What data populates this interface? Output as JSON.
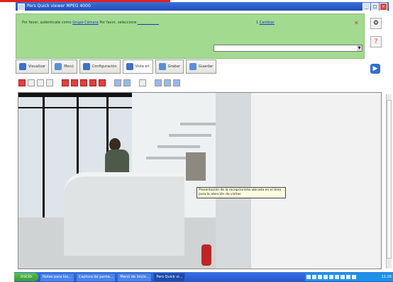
{
  "window": {
    "title": "Pers Quick viewer MPEG 4000"
  },
  "info_bar": {
    "prefix": "Por favor, autenticate como",
    "user_link": "Grupo Cámara",
    "mid": "Por favor, seleccione",
    "select_link": "____________",
    "date_link": "Cambiar",
    "close_glyph": "✕"
  },
  "tabs": [
    {
      "label": "Visualizar"
    },
    {
      "label": "Menú"
    },
    {
      "label": "Configuración"
    },
    {
      "label": "Vista en"
    },
    {
      "label": "Grabar"
    },
    {
      "label": "Guardar"
    }
  ],
  "camera": {
    "tooltip": "Presentación de la recepcionista ubicada en el área para la atención de visitas"
  },
  "taskbar": {
    "start": "Inicio",
    "tasks": [
      {
        "label": "Notas para los..."
      },
      {
        "label": "Captura de panta..."
      },
      {
        "label": "Menú de inicio..."
      },
      {
        "label": "Pers Quick vi..."
      }
    ],
    "clock": "11:26"
  },
  "icons": {
    "settings": "settings-icon",
    "help": "help-icon",
    "play": "play-icon"
  }
}
